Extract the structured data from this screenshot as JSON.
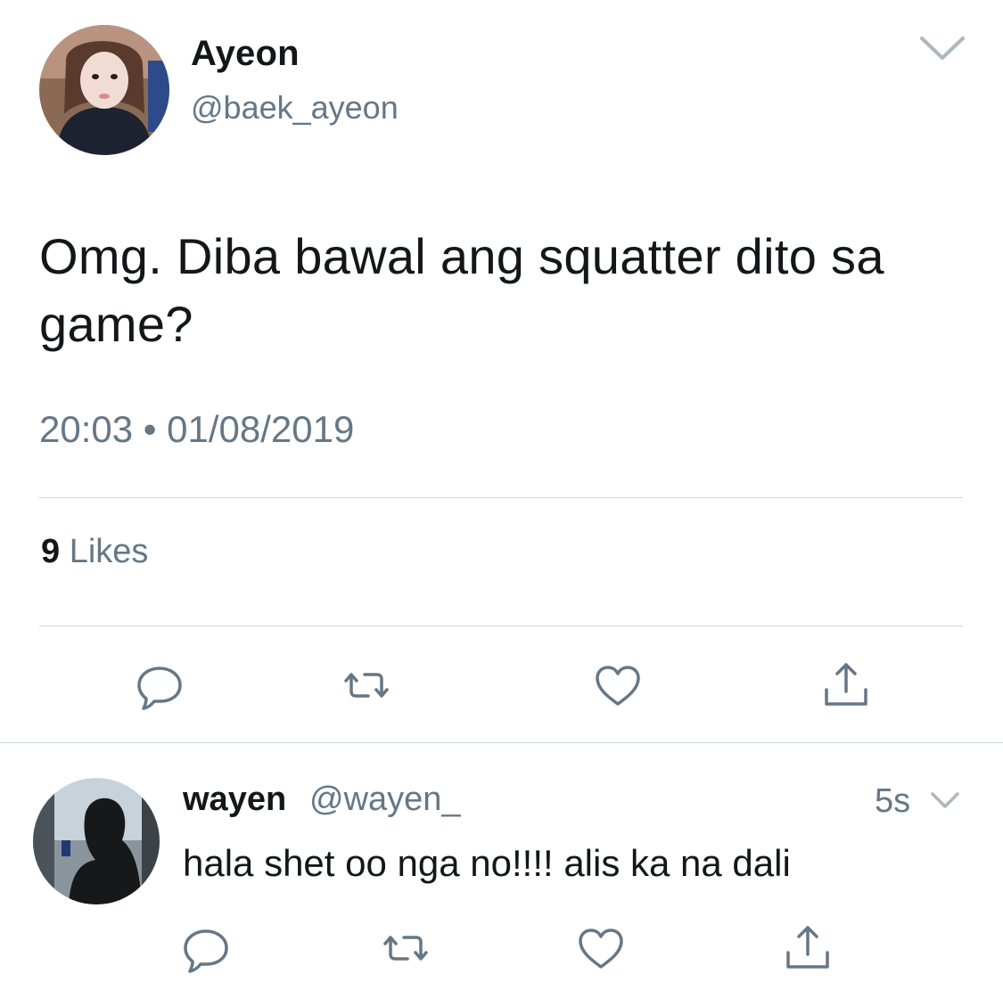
{
  "tweet": {
    "display_name": "Ayeon",
    "handle": "@baek_ayeon",
    "text": "Omg. Diba bawal ang squatter dito sa game?",
    "timestamp": "20:03 • 01/08/2019",
    "likes_count": "9",
    "likes_label": "Likes",
    "avatar_icon": "user-avatar-photo",
    "menu_icon": "chevron-down-icon",
    "actions": [
      "reply-icon",
      "retweet-icon",
      "like-icon",
      "share-icon"
    ]
  },
  "reply": {
    "display_name": "wayen",
    "handle": "@wayen_",
    "time": "5s",
    "text": "hala shet oo nga no!!!! alis ka na dali",
    "avatar_icon": "user-avatar-photo",
    "menu_icon": "chevron-down-icon",
    "actions": [
      "reply-icon",
      "retweet-icon",
      "like-icon",
      "share-icon"
    ]
  },
  "colors": {
    "primary_text": "#14171a",
    "secondary_text": "#657786",
    "icon_gray": "#657786",
    "divider": "#cfd6dc"
  }
}
